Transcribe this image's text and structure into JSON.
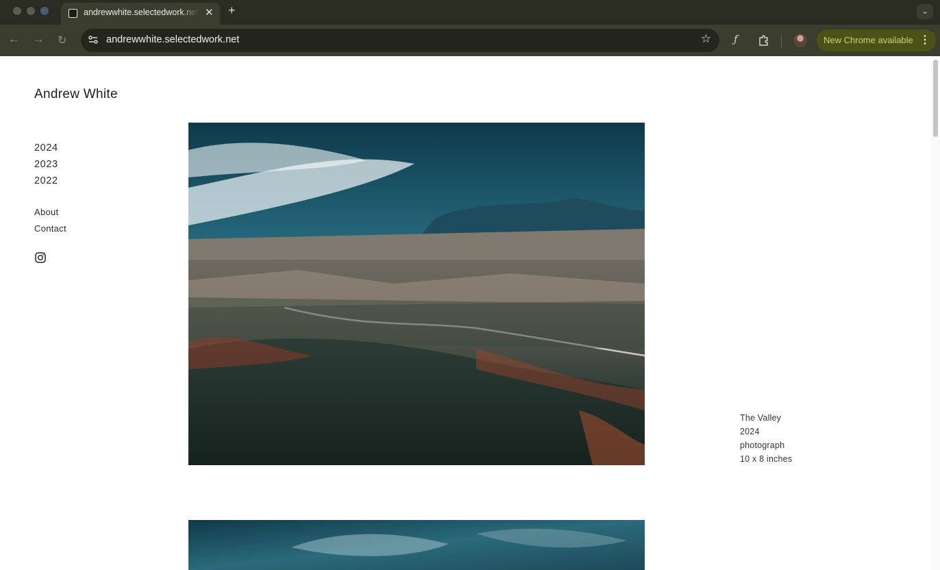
{
  "browser": {
    "tab_title": "andrewwhite.selectedwork.net",
    "url": "andrewwhite.selectedwork.net",
    "update_label": "New Chrome available",
    "icons": [
      "back-icon",
      "forward-icon",
      "reload-icon",
      "site-settings-icon",
      "bookmark-star-icon",
      "functions-icon",
      "extensions-icon",
      "profile-avatar",
      "more-menu-icon"
    ]
  },
  "site": {
    "title": "Andrew White",
    "years": [
      "2024",
      "2023",
      "2022"
    ],
    "pages": [
      "About",
      "Contact"
    ],
    "social": "instagram-icon"
  },
  "artwork": {
    "title": "The Valley",
    "year": "2024",
    "medium": "photograph",
    "dimensions": "10 x 8 inches"
  },
  "colors": {
    "chrome_bg": "#2a2c22",
    "toolbar_bg": "#3b3d2f",
    "update_pill": "#4a5315",
    "page_bg": "#ffffff",
    "text": "#1e1e1e"
  }
}
